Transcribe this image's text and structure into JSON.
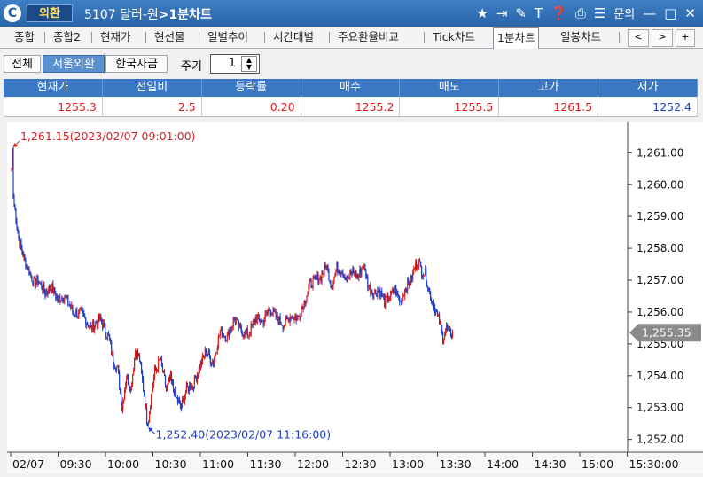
{
  "titlebar": {
    "logo": "C",
    "badge": "외환",
    "code": "5107 달러-원",
    "separator": ">",
    "screen": "1분차트",
    "icons": [
      "star-icon",
      "export-icon",
      "link-icon",
      "text-icon",
      "help-icon",
      "print-icon",
      "menu-icon"
    ],
    "inquiry": "문의",
    "min": "—",
    "max": "□",
    "close": "✕"
  },
  "tabs": [
    {
      "label": "종합",
      "active": false
    },
    {
      "label": "종합2",
      "active": false
    },
    {
      "label": "현재가",
      "active": false
    },
    {
      "label": "현선물",
      "active": false
    },
    {
      "label": "일별추이",
      "active": false
    },
    {
      "label": "시간대별",
      "active": false
    },
    {
      "label": "주요환율비교",
      "active": false
    },
    {
      "label": "Tick차트",
      "active": false
    },
    {
      "label": "1분차트",
      "active": true
    },
    {
      "label": "일봉차트",
      "active": false
    }
  ],
  "tab_nav": {
    "prev": "<",
    "next": ">",
    "add": "+"
  },
  "toolbar": {
    "btn_all": "전체",
    "btn_seoul": "서울외환",
    "btn_korea": "한국자금",
    "period_label": "주기",
    "period_value": "1",
    "spin_up": "▲",
    "spin_down": "▼"
  },
  "quote": {
    "headers": [
      "현재가",
      "전일비",
      "등락률",
      "매수",
      "매도",
      "고가",
      "저가"
    ],
    "values": [
      "1255.3",
      "2.5",
      "0.20",
      "1255.2",
      "1255.5",
      "1261.5",
      "1252.4"
    ],
    "value_colors": [
      "#d62020",
      "#d62020",
      "#d62020",
      "#d62020",
      "#d62020",
      "#d62020",
      "#1d3fc4"
    ]
  },
  "chart_data": {
    "type": "candlestick",
    "y_ticks": [
      "1,261.00",
      "1,260.00",
      "1,259.00",
      "1,258.00",
      "1,257.00",
      "1,256.00",
      "1,255.00",
      "1,254.00",
      "1,253.00",
      "1,252.00"
    ],
    "y_tick_values": [
      1261,
      1260,
      1259,
      1258,
      1257,
      1256,
      1255,
      1254,
      1253,
      1252
    ],
    "ylim": [
      1251.6,
      1261.9
    ],
    "x_ticks": [
      "02/07",
      "09:30",
      "10:00",
      "10:30",
      "11:00",
      "11:30",
      "12:00",
      "12:30",
      "13:00",
      "13:30",
      "14:00",
      "14:30",
      "15:00",
      "15:30:00"
    ],
    "high_annotation": "1,261.15(2023/02/07 09:01:00)",
    "low_annotation": "1,252.40(2023/02/07 11:16:00)",
    "high_value": 1261.15,
    "low_value": 1252.4,
    "current_label": "1,255.35",
    "current_value": 1255.35,
    "up_color": "#d62020",
    "down_color": "#1d3fc4",
    "grid": false,
    "path_keypoints": [
      [
        0,
        1260.5
      ],
      [
        1,
        1261.15
      ],
      [
        2,
        1259.6
      ],
      [
        4,
        1259.2
      ],
      [
        8,
        1258.3
      ],
      [
        15,
        1257.6
      ],
      [
        20,
        1257.3
      ],
      [
        25,
        1256.9
      ],
      [
        30,
        1257.0
      ],
      [
        38,
        1256.6
      ],
      [
        45,
        1256.8
      ],
      [
        52,
        1256.4
      ],
      [
        60,
        1256.5
      ],
      [
        70,
        1256.0
      ],
      [
        80,
        1255.9
      ],
      [
        90,
        1255.5
      ],
      [
        100,
        1255.8
      ],
      [
        110,
        1255.2
      ],
      [
        115,
        1254.5
      ],
      [
        120,
        1254.2
      ],
      [
        125,
        1253.0
      ],
      [
        130,
        1254.0
      ],
      [
        135,
        1253.6
      ],
      [
        140,
        1254.8
      ],
      [
        145,
        1254.5
      ],
      [
        150,
        1253.4
      ],
      [
        154,
        1252.4
      ],
      [
        158,
        1253.4
      ],
      [
        162,
        1254.1
      ],
      [
        168,
        1254.5
      ],
      [
        175,
        1253.6
      ],
      [
        180,
        1253.9
      ],
      [
        186,
        1253.3
      ],
      [
        192,
        1253.0
      ],
      [
        198,
        1253.6
      ],
      [
        205,
        1253.7
      ],
      [
        212,
        1254.2
      ],
      [
        220,
        1254.8
      ],
      [
        228,
        1254.4
      ],
      [
        236,
        1255.4
      ],
      [
        244,
        1255.2
      ],
      [
        252,
        1255.8
      ],
      [
        260,
        1255.4
      ],
      [
        268,
        1255.3
      ],
      [
        276,
        1255.8
      ],
      [
        284,
        1255.7
      ],
      [
        292,
        1256.1
      ],
      [
        300,
        1255.8
      ],
      [
        308,
        1255.6
      ],
      [
        316,
        1255.9
      ],
      [
        324,
        1255.8
      ],
      [
        332,
        1256.4
      ],
      [
        338,
        1256.9
      ],
      [
        344,
        1257.0
      ],
      [
        350,
        1257.1
      ],
      [
        356,
        1257.5
      ],
      [
        362,
        1256.8
      ],
      [
        368,
        1257.4
      ],
      [
        374,
        1257.3
      ],
      [
        380,
        1257.0
      ],
      [
        386,
        1257.3
      ],
      [
        392,
        1257.1
      ],
      [
        398,
        1257.5
      ],
      [
        404,
        1256.8
      ],
      [
        410,
        1256.6
      ],
      [
        416,
        1256.7
      ],
      [
        422,
        1256.3
      ],
      [
        428,
        1256.5
      ],
      [
        434,
        1256.7
      ],
      [
        440,
        1256.3
      ],
      [
        446,
        1256.8
      ],
      [
        452,
        1257.0
      ],
      [
        456,
        1257.4
      ],
      [
        460,
        1257.6
      ],
      [
        464,
        1257.3
      ],
      [
        468,
        1257.2
      ],
      [
        472,
        1256.7
      ],
      [
        476,
        1256.3
      ],
      [
        480,
        1256.0
      ],
      [
        484,
        1255.7
      ],
      [
        488,
        1255.2
      ],
      [
        492,
        1255.5
      ],
      [
        496,
        1255.35
      ]
    ],
    "last_index": 499,
    "total_slots": 690
  }
}
